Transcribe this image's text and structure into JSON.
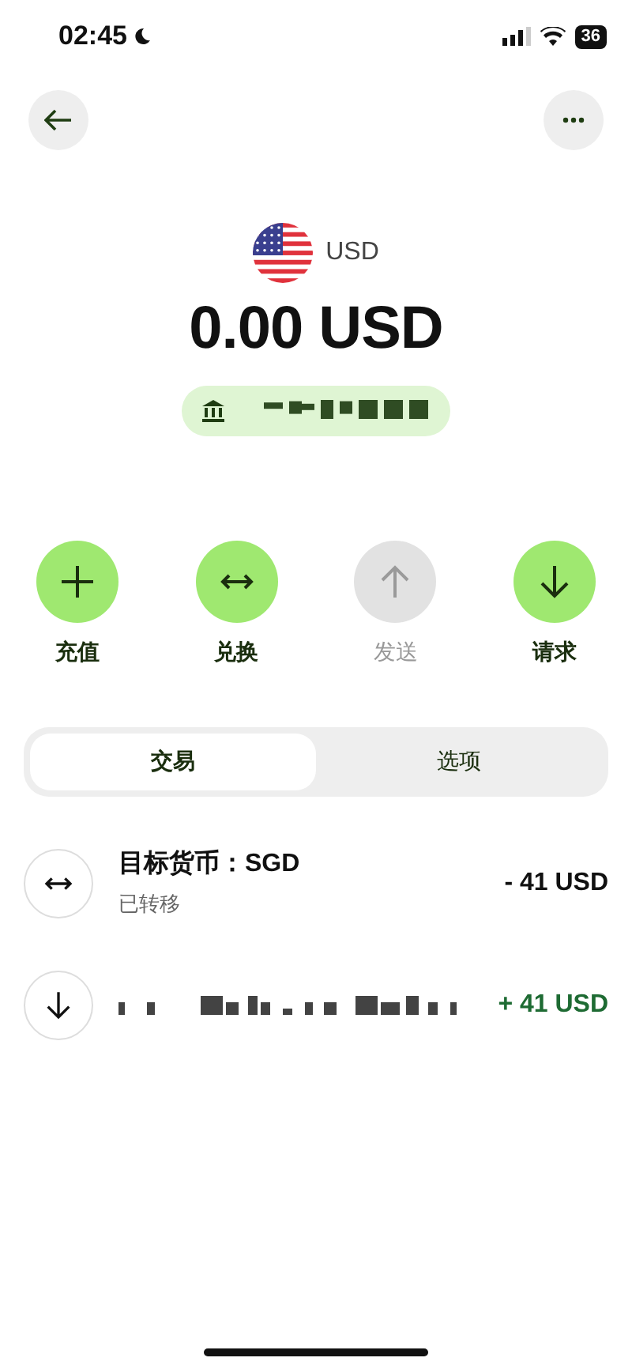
{
  "status_bar": {
    "time": "02:45",
    "battery": "36"
  },
  "account": {
    "currency": "USD",
    "balance": "0.00 USD"
  },
  "actions": [
    {
      "kind": "add",
      "label": "充值",
      "disabled": false
    },
    {
      "kind": "exchange",
      "label": "兑换",
      "disabled": false
    },
    {
      "kind": "send",
      "label": "发送",
      "disabled": true
    },
    {
      "kind": "request",
      "label": "请求",
      "disabled": false
    }
  ],
  "tabs": [
    {
      "label": "交易",
      "selected": true
    },
    {
      "label": "选项",
      "selected": false
    }
  ],
  "transactions": [
    {
      "kind": "exchange",
      "title": "目标货币：SGD",
      "subtitle": "已转移",
      "amount": "- 41 USD"
    },
    {
      "kind": "incoming",
      "amount": "+ 41 USD"
    }
  ]
}
